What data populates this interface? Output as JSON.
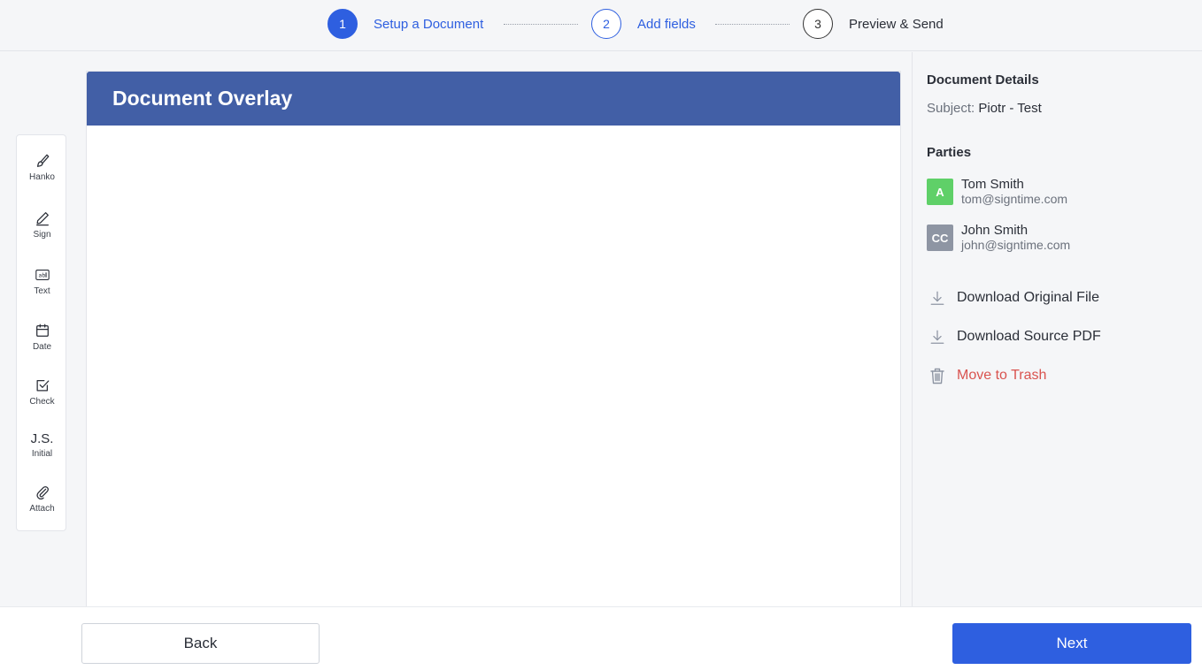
{
  "stepper": {
    "steps": [
      {
        "num": "1",
        "label": "Setup a Document",
        "state": "active"
      },
      {
        "num": "2",
        "label": "Add fields",
        "state": "done"
      },
      {
        "num": "3",
        "label": "Preview & Send",
        "state": "todo"
      }
    ]
  },
  "tools": [
    {
      "label": "Hanko",
      "icon": "brush-icon"
    },
    {
      "label": "Sign",
      "icon": "pen-icon"
    },
    {
      "label": "Text",
      "icon": "text-field-icon"
    },
    {
      "label": "Date",
      "icon": "calendar-icon"
    },
    {
      "label": "Check",
      "icon": "checkbox-icon"
    },
    {
      "label": "Initial",
      "icon": "initials-icon",
      "glyph": "J.S."
    },
    {
      "label": "Attach",
      "icon": "paperclip-icon"
    }
  ],
  "document": {
    "title": "Document Overlay"
  },
  "details": {
    "title": "Document Details",
    "subject_key": "Subject:",
    "subject_value": "Piotr - Test",
    "parties_title": "Parties",
    "parties": [
      {
        "badge": "A",
        "name": "Tom Smith",
        "email": "tom@signtime.com",
        "color": "#5fd068"
      },
      {
        "badge": "CC",
        "name": "John Smith",
        "email": "john@signtime.com",
        "color": "#8e95a3"
      }
    ],
    "actions": [
      {
        "label": "Download Original File",
        "icon": "download-icon"
      },
      {
        "label": "Download Source PDF",
        "icon": "download-icon"
      },
      {
        "label": "Move to Trash",
        "icon": "trash-icon"
      }
    ]
  },
  "footer": {
    "back_label": "Back",
    "next_label": "Next"
  },
  "colors": {
    "accent": "#2e5fe0",
    "header": "#425fa6",
    "danger": "#d9534f"
  }
}
